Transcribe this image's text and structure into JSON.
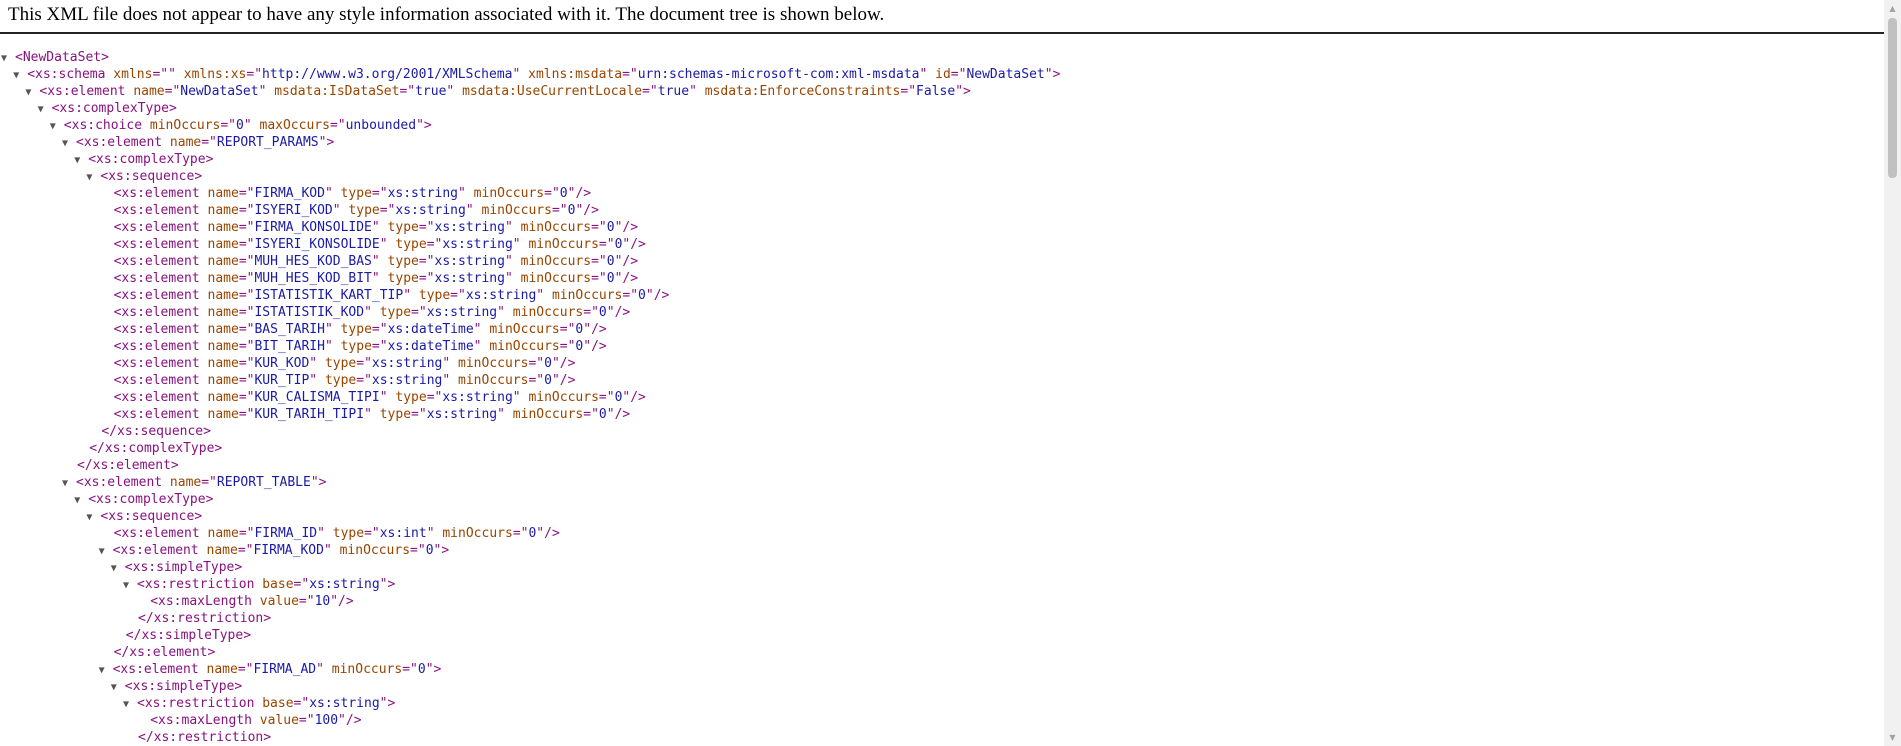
{
  "header": {
    "message": "This XML file does not appear to have any style information associated with it. The document tree is shown below."
  },
  "tree": [
    {
      "indent": 0,
      "toggle": true,
      "kind": "open",
      "tag": "NewDataSet",
      "attrs": []
    },
    {
      "indent": 1,
      "toggle": true,
      "kind": "open",
      "tag": "xs:schema",
      "attrs": [
        [
          "xmlns",
          ""
        ],
        [
          "xmlns:xs",
          "http://www.w3.org/2001/XMLSchema"
        ],
        [
          "xmlns:msdata",
          "urn:schemas-microsoft-com:xml-msdata"
        ],
        [
          "id",
          "NewDataSet"
        ]
      ]
    },
    {
      "indent": 2,
      "toggle": true,
      "kind": "open",
      "tag": "xs:element",
      "attrs": [
        [
          "name",
          "NewDataSet"
        ],
        [
          "msdata:IsDataSet",
          "true"
        ],
        [
          "msdata:UseCurrentLocale",
          "true"
        ],
        [
          "msdata:EnforceConstraints",
          "False"
        ]
      ]
    },
    {
      "indent": 3,
      "toggle": true,
      "kind": "open",
      "tag": "xs:complexType",
      "attrs": []
    },
    {
      "indent": 4,
      "toggle": true,
      "kind": "open",
      "tag": "xs:choice",
      "attrs": [
        [
          "minOccurs",
          "0"
        ],
        [
          "maxOccurs",
          "unbounded"
        ]
      ]
    },
    {
      "indent": 5,
      "toggle": true,
      "kind": "open",
      "tag": "xs:element",
      "attrs": [
        [
          "name",
          "REPORT_PARAMS"
        ]
      ]
    },
    {
      "indent": 6,
      "toggle": true,
      "kind": "open",
      "tag": "xs:complexType",
      "attrs": []
    },
    {
      "indent": 7,
      "toggle": true,
      "kind": "open",
      "tag": "xs:sequence",
      "attrs": []
    },
    {
      "indent": 8,
      "toggle": false,
      "kind": "self",
      "tag": "xs:element",
      "attrs": [
        [
          "name",
          "FIRMA_KOD"
        ],
        [
          "type",
          "xs:string"
        ],
        [
          "minOccurs",
          "0"
        ]
      ]
    },
    {
      "indent": 8,
      "toggle": false,
      "kind": "self",
      "tag": "xs:element",
      "attrs": [
        [
          "name",
          "ISYERI_KOD"
        ],
        [
          "type",
          "xs:string"
        ],
        [
          "minOccurs",
          "0"
        ]
      ]
    },
    {
      "indent": 8,
      "toggle": false,
      "kind": "self",
      "tag": "xs:element",
      "attrs": [
        [
          "name",
          "FIRMA_KONSOLIDE"
        ],
        [
          "type",
          "xs:string"
        ],
        [
          "minOccurs",
          "0"
        ]
      ]
    },
    {
      "indent": 8,
      "toggle": false,
      "kind": "self",
      "tag": "xs:element",
      "attrs": [
        [
          "name",
          "ISYERI_KONSOLIDE"
        ],
        [
          "type",
          "xs:string"
        ],
        [
          "minOccurs",
          "0"
        ]
      ]
    },
    {
      "indent": 8,
      "toggle": false,
      "kind": "self",
      "tag": "xs:element",
      "attrs": [
        [
          "name",
          "MUH_HES_KOD_BAS"
        ],
        [
          "type",
          "xs:string"
        ],
        [
          "minOccurs",
          "0"
        ]
      ]
    },
    {
      "indent": 8,
      "toggle": false,
      "kind": "self",
      "tag": "xs:element",
      "attrs": [
        [
          "name",
          "MUH_HES_KOD_BIT"
        ],
        [
          "type",
          "xs:string"
        ],
        [
          "minOccurs",
          "0"
        ]
      ]
    },
    {
      "indent": 8,
      "toggle": false,
      "kind": "self",
      "tag": "xs:element",
      "attrs": [
        [
          "name",
          "ISTATISTIK_KART_TIP"
        ],
        [
          "type",
          "xs:string"
        ],
        [
          "minOccurs",
          "0"
        ]
      ]
    },
    {
      "indent": 8,
      "toggle": false,
      "kind": "self",
      "tag": "xs:element",
      "attrs": [
        [
          "name",
          "ISTATISTIK_KOD"
        ],
        [
          "type",
          "xs:string"
        ],
        [
          "minOccurs",
          "0"
        ]
      ]
    },
    {
      "indent": 8,
      "toggle": false,
      "kind": "self",
      "tag": "xs:element",
      "attrs": [
        [
          "name",
          "BAS_TARIH"
        ],
        [
          "type",
          "xs:dateTime"
        ],
        [
          "minOccurs",
          "0"
        ]
      ]
    },
    {
      "indent": 8,
      "toggle": false,
      "kind": "self",
      "tag": "xs:element",
      "attrs": [
        [
          "name",
          "BIT_TARIH"
        ],
        [
          "type",
          "xs:dateTime"
        ],
        [
          "minOccurs",
          "0"
        ]
      ]
    },
    {
      "indent": 8,
      "toggle": false,
      "kind": "self",
      "tag": "xs:element",
      "attrs": [
        [
          "name",
          "KUR_KOD"
        ],
        [
          "type",
          "xs:string"
        ],
        [
          "minOccurs",
          "0"
        ]
      ]
    },
    {
      "indent": 8,
      "toggle": false,
      "kind": "self",
      "tag": "xs:element",
      "attrs": [
        [
          "name",
          "KUR_TIP"
        ],
        [
          "type",
          "xs:string"
        ],
        [
          "minOccurs",
          "0"
        ]
      ]
    },
    {
      "indent": 8,
      "toggle": false,
      "kind": "self",
      "tag": "xs:element",
      "attrs": [
        [
          "name",
          "KUR_CALISMA_TIPI"
        ],
        [
          "type",
          "xs:string"
        ],
        [
          "minOccurs",
          "0"
        ]
      ]
    },
    {
      "indent": 8,
      "toggle": false,
      "kind": "self",
      "tag": "xs:element",
      "attrs": [
        [
          "name",
          "KUR_TARIH_TIPI"
        ],
        [
          "type",
          "xs:string"
        ],
        [
          "minOccurs",
          "0"
        ]
      ]
    },
    {
      "indent": 7,
      "toggle": false,
      "kind": "close",
      "tag": "xs:sequence",
      "attrs": []
    },
    {
      "indent": 6,
      "toggle": false,
      "kind": "close",
      "tag": "xs:complexType",
      "attrs": []
    },
    {
      "indent": 5,
      "toggle": false,
      "kind": "close",
      "tag": "xs:element",
      "attrs": []
    },
    {
      "indent": 5,
      "toggle": true,
      "kind": "open",
      "tag": "xs:element",
      "attrs": [
        [
          "name",
          "REPORT_TABLE"
        ]
      ]
    },
    {
      "indent": 6,
      "toggle": true,
      "kind": "open",
      "tag": "xs:complexType",
      "attrs": []
    },
    {
      "indent": 7,
      "toggle": true,
      "kind": "open",
      "tag": "xs:sequence",
      "attrs": []
    },
    {
      "indent": 8,
      "toggle": false,
      "kind": "self",
      "tag": "xs:element",
      "attrs": [
        [
          "name",
          "FIRMA_ID"
        ],
        [
          "type",
          "xs:int"
        ],
        [
          "minOccurs",
          "0"
        ]
      ]
    },
    {
      "indent": 8,
      "toggle": true,
      "kind": "open",
      "tag": "xs:element",
      "attrs": [
        [
          "name",
          "FIRMA_KOD"
        ],
        [
          "minOccurs",
          "0"
        ]
      ]
    },
    {
      "indent": 9,
      "toggle": true,
      "kind": "open",
      "tag": "xs:simpleType",
      "attrs": []
    },
    {
      "indent": 10,
      "toggle": true,
      "kind": "open",
      "tag": "xs:restriction",
      "attrs": [
        [
          "base",
          "xs:string"
        ]
      ]
    },
    {
      "indent": 11,
      "toggle": false,
      "kind": "self",
      "tag": "xs:maxLength",
      "attrs": [
        [
          "value",
          "10"
        ]
      ]
    },
    {
      "indent": 10,
      "toggle": false,
      "kind": "close",
      "tag": "xs:restriction",
      "attrs": []
    },
    {
      "indent": 9,
      "toggle": false,
      "kind": "close",
      "tag": "xs:simpleType",
      "attrs": []
    },
    {
      "indent": 8,
      "toggle": false,
      "kind": "close",
      "tag": "xs:element",
      "attrs": []
    },
    {
      "indent": 8,
      "toggle": true,
      "kind": "open",
      "tag": "xs:element",
      "attrs": [
        [
          "name",
          "FIRMA_AD"
        ],
        [
          "minOccurs",
          "0"
        ]
      ]
    },
    {
      "indent": 9,
      "toggle": true,
      "kind": "open",
      "tag": "xs:simpleType",
      "attrs": []
    },
    {
      "indent": 10,
      "toggle": true,
      "kind": "open",
      "tag": "xs:restriction",
      "attrs": [
        [
          "base",
          "xs:string"
        ]
      ]
    },
    {
      "indent": 11,
      "toggle": false,
      "kind": "self",
      "tag": "xs:maxLength",
      "attrs": [
        [
          "value",
          "100"
        ]
      ]
    },
    {
      "indent": 10,
      "toggle": false,
      "kind": "close",
      "tag": "xs:restriction",
      "attrs": []
    }
  ],
  "icons": {
    "toggle": "triangle-down-icon",
    "scroll_up": "arrow-up-icon",
    "scroll_down": "arrow-down-icon"
  },
  "colors": {
    "tag": "#881280",
    "attr_name": "#994500",
    "attr_value": "#1a1aa6"
  }
}
